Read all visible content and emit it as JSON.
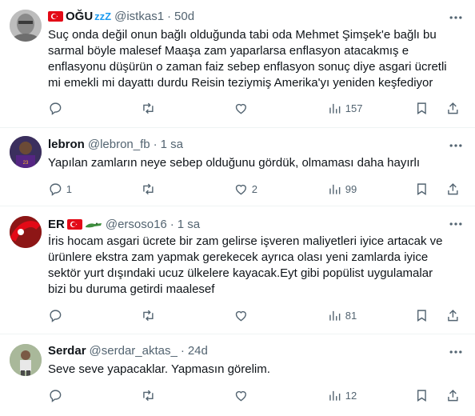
{
  "tweets": [
    {
      "name": "OĞU",
      "badge": "zzZ",
      "handle": "@istkas1",
      "time": "50d",
      "text": "Suç onda değil onun bağlı olduğunda tabi oda Mehmet Şimşek'e bağlı bu sarmal böyle malesef Maaşa zam yaparlarsa enflasyon atacakmış e enflasyonu düşürün o zaman faiz sebep enflasyon sonuç diye asgari ücretli mi emekli mi dayattı durdu Reisin teziymiş Amerika'yı yeniden keşfediyor",
      "replies": "",
      "reposts": "",
      "likes": "",
      "views": "157"
    },
    {
      "name": "lebron",
      "handle": "@lebron_fb",
      "time": "1 sa",
      "text": "Yapılan zamların neye sebep olduğunu gördük, olmaması daha hayırlı",
      "replies": "1",
      "reposts": "",
      "likes": "2",
      "views": "99"
    },
    {
      "name": "ER",
      "handle": "@ersoso16",
      "time": "1 sa",
      "text": "İris hocam asgari ücrete bir zam gelirse işveren maliyetleri iyice artacak ve ürünlere ekstra zam yapmak gerekecek ayrıca olası yeni zamlarda iyice sektör yurt dışındaki ucuz ülkelere kayacak.Eyt gibi popülist uygulamalar bizi bu duruma getirdi maalesef",
      "replies": "",
      "reposts": "",
      "likes": "",
      "views": "81"
    },
    {
      "name": "Serdar",
      "handle": "@serdar_aktas_",
      "time": "24d",
      "text": "Seve seve yapacaklar. Yapmasın görelim.",
      "replies": "",
      "reposts": "",
      "likes": "",
      "views": "12"
    }
  ],
  "colors": {
    "text": "#0f1419",
    "secondary": "#536471",
    "border": "#eff3f4",
    "accent": "#1d9bf0",
    "flag": "#e30a17"
  }
}
